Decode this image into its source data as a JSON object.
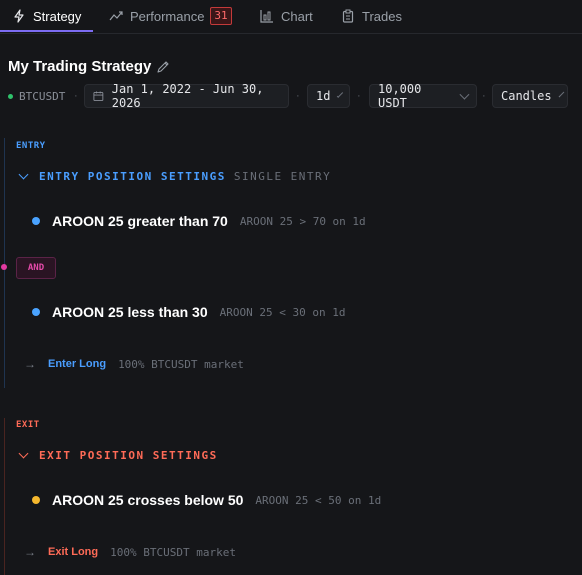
{
  "tabs": [
    {
      "label": "Strategy",
      "icon": "lightning-icon"
    },
    {
      "label": "Performance",
      "icon": "trend-icon",
      "badge": "31"
    },
    {
      "label": "Chart",
      "icon": "chart-icon"
    },
    {
      "label": "Trades",
      "icon": "clipboard-icon"
    }
  ],
  "header": {
    "title": "My Trading Strategy",
    "symbol": "BTCUSDT",
    "date_range": "Jan 1, 2022 - Jun 30, 2026",
    "timeframe": "1d",
    "capital": "10,000 USDT",
    "chart_type": "Candles",
    "sep": "·"
  },
  "entry": {
    "section_label": "ENTRY",
    "settings_label": "ENTRY POSITION SETTINGS",
    "settings_sub": "SINGLE ENTRY",
    "conditions": [
      {
        "name": "AROON 25 greater than 70",
        "detail": "AROON 25 > 70 on 1d"
      },
      {
        "name": "AROON 25 less than 30",
        "detail": "AROON 25 < 30 on 1d"
      }
    ],
    "connector": "AND",
    "action_arrow": "→",
    "action_label": "Enter Long",
    "action_detail": "100% BTCUSDT market"
  },
  "exit": {
    "section_label": "EXIT",
    "settings_label": "EXIT POSITION SETTINGS",
    "conditions": [
      {
        "name": "AROON 25 crosses below 50",
        "detail": "AROON 25 < 50 on 1d"
      }
    ],
    "action_arrow": "→",
    "action_label": "Exit Long",
    "action_detail": "100% BTCUSDT market"
  },
  "colors": {
    "accent": "#7c6cf2",
    "entry": "#4a9eff",
    "exit": "#ff6b57",
    "and": "#e64aaa",
    "bullet_blue": "#4aa3ff",
    "bullet_yellow": "#f5b82e"
  }
}
